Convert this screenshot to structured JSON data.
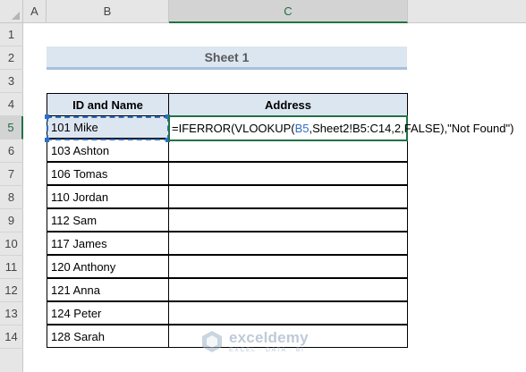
{
  "columns": [
    "A",
    "B",
    "C"
  ],
  "active_column": "C",
  "rows": [
    "1",
    "2",
    "3",
    "4",
    "5",
    "6",
    "7",
    "8",
    "9",
    "10",
    "11",
    "12",
    "13",
    "14"
  ],
  "active_row": "5",
  "sheet_title": "Sheet 1",
  "table": {
    "headers": [
      "ID and Name",
      "Address"
    ],
    "rows": [
      {
        "id_name": "101 Mike",
        "address": ""
      },
      {
        "id_name": "103 Ashton",
        "address": ""
      },
      {
        "id_name": "106 Tomas",
        "address": ""
      },
      {
        "id_name": "110 Jordan",
        "address": ""
      },
      {
        "id_name": "112 Sam",
        "address": ""
      },
      {
        "id_name": "117 James",
        "address": ""
      },
      {
        "id_name": "120 Anthony",
        "address": ""
      },
      {
        "id_name": "121 Anna",
        "address": ""
      },
      {
        "id_name": "124 Peter",
        "address": ""
      },
      {
        "id_name": "128 Sarah",
        "address": ""
      }
    ]
  },
  "formula": {
    "prefix": "=IFERROR(VLOOKUP(",
    "ref": "B5",
    "suffix": ",Sheet2!B5:C14,2,FALSE),\"Not Found\")"
  },
  "watermark": {
    "name": "exceldemy",
    "tagline": "EXCEL · DATA · BI"
  },
  "colors": {
    "header_fill": "#dce6f1",
    "accent_green": "#217346",
    "reference_blue": "#2f6fc2"
  }
}
